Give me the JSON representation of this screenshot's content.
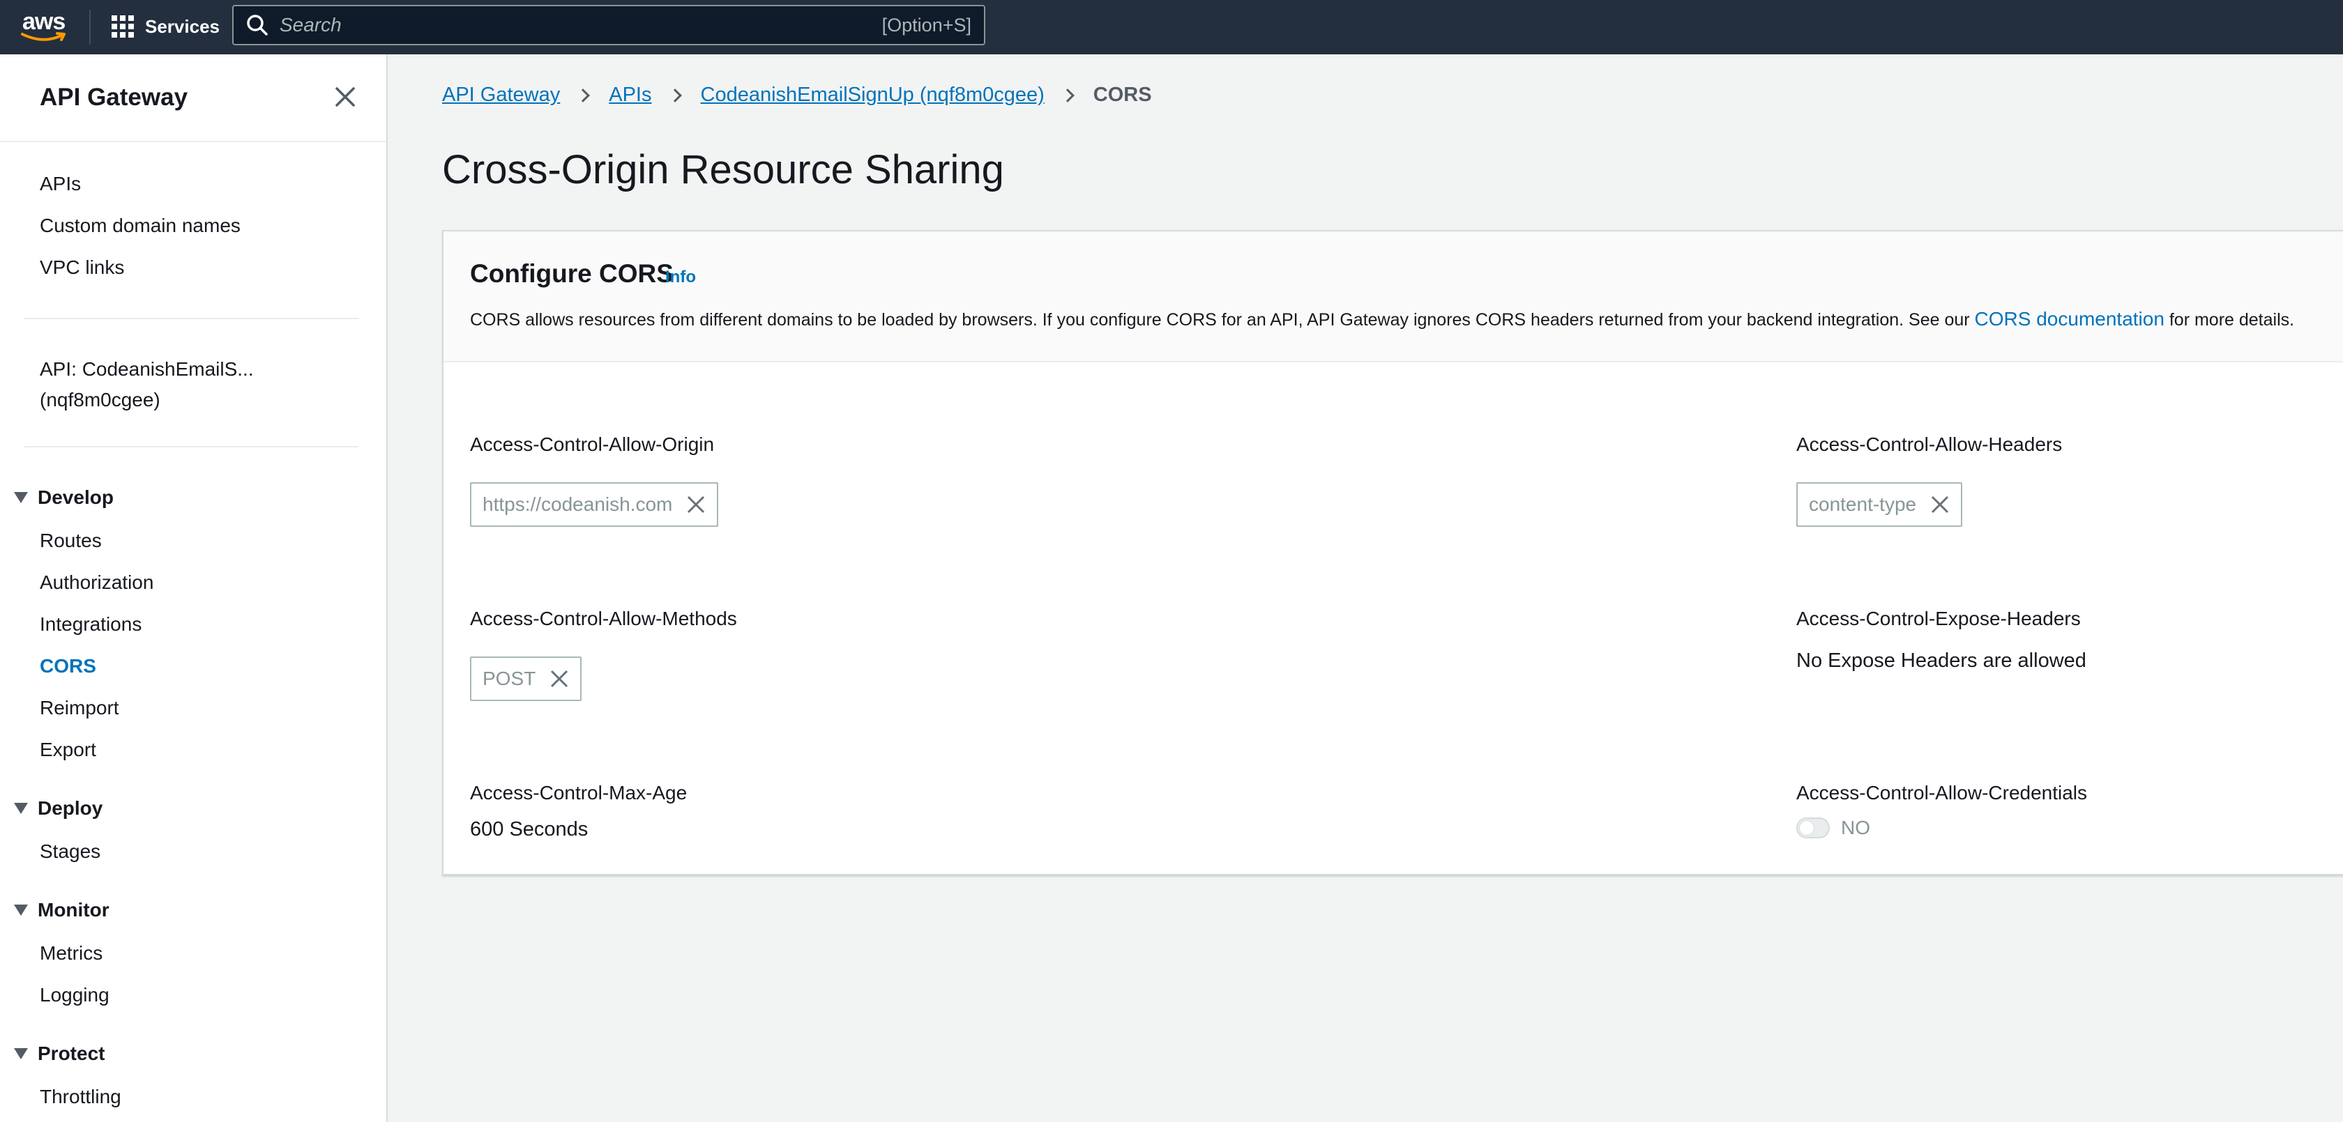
{
  "topnav": {
    "logo_text": "aws",
    "services_label": "Services",
    "search_placeholder": "Search",
    "search_shortcut": "[Option+S]"
  },
  "sidebar": {
    "title": "API Gateway",
    "top_links": [
      "APIs",
      "Custom domain names",
      "VPC links"
    ],
    "api_label_line1": "API: CodeanishEmailS...",
    "api_label_line2": "(nqf8m0cgee)",
    "sections": {
      "develop": "Develop",
      "deploy": "Deploy",
      "monitor": "Monitor",
      "protect": "Protect"
    },
    "develop_links": [
      "Routes",
      "Authorization",
      "Integrations",
      "CORS",
      "Reimport",
      "Export"
    ],
    "deploy_links": [
      "Stages"
    ],
    "monitor_links": [
      "Metrics",
      "Logging"
    ],
    "protect_links": [
      "Throttling"
    ]
  },
  "breadcrumb": {
    "items": [
      "API Gateway",
      "APIs",
      "CodeanishEmailSignUp (nqf8m0cgee)"
    ],
    "current": "CORS"
  },
  "page_title": "Cross-Origin Resource Sharing",
  "panel": {
    "title": "Configure CORS",
    "info": "Info",
    "desc_before": "CORS allows resources from different domains to be loaded by browsers. If you configure CORS for an API, API Gateway ignores CORS headers returned from your backend integration. See our ",
    "desc_link": "CORS documentation",
    "desc_after": " for more details."
  },
  "fields": {
    "allow_origin": {
      "label": "Access-Control-Allow-Origin",
      "token": "https://codeanish.com"
    },
    "allow_headers": {
      "label": "Access-Control-Allow-Headers",
      "token": "content-type"
    },
    "allow_methods": {
      "label": "Access-Control-Allow-Methods",
      "token": "POST"
    },
    "expose_headers": {
      "label": "Access-Control-Expose-Headers",
      "value": "No Expose Headers are allowed"
    },
    "max_age": {
      "label": "Access-Control-Max-Age",
      "value": "600 Seconds"
    },
    "allow_credentials": {
      "label": "Access-Control-Allow-Credentials",
      "toggle_label": "NO",
      "enabled": false
    }
  },
  "colors": {
    "nav_bg": "#232f3e",
    "link": "#0073bb",
    "text": "#16191f",
    "muted": "#879596",
    "page_bg": "#f2f3f3"
  }
}
